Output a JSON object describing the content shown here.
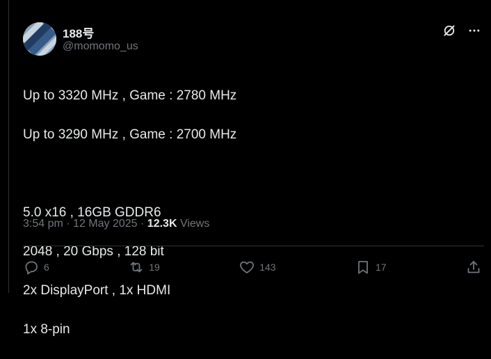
{
  "author": {
    "name": "188号",
    "handle": "@momomo_us"
  },
  "post": {
    "lines": [
      "Up to 3320 MHz , Game : 2780 MHz",
      "Up to 3290 MHz , Game : 2700 MHz",
      "",
      "5.0 x16 , 16GB GDDR6",
      "2048 , 20 Gbps , 128 bit",
      "2x DisplayPort , 1x HDMI",
      "1x 8-pin"
    ]
  },
  "meta": {
    "time": "3:54 pm",
    "sep": "·",
    "date": "12 May 2025",
    "views_count": "12.3K",
    "views_label": "Views"
  },
  "actions": {
    "replies": "6",
    "reposts": "19",
    "likes": "143",
    "bookmarks": "17"
  },
  "icons": {
    "top": [
      "grok-icon",
      "more-icon"
    ],
    "actions": [
      "reply-icon",
      "repost-icon",
      "like-icon",
      "bookmark-icon",
      "share-icon"
    ]
  },
  "colors": {
    "background": "#000000",
    "text": "#e7e9ea",
    "muted": "#71767b",
    "divider": "#2f3336"
  }
}
